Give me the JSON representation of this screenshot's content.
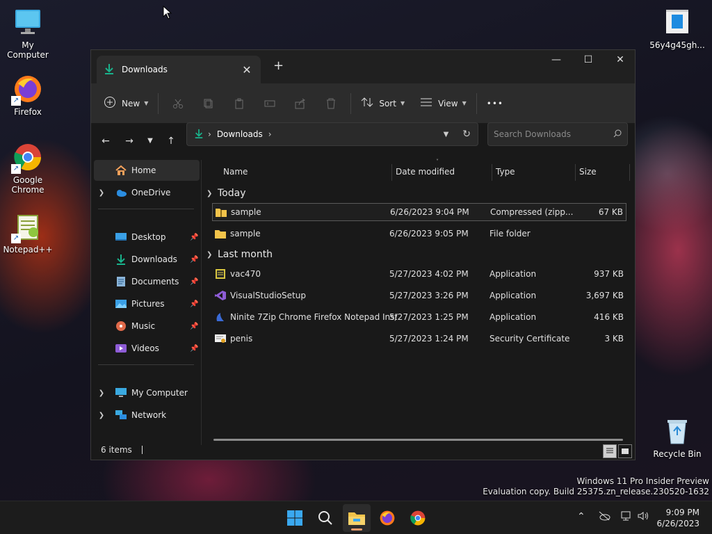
{
  "desktop": {
    "icons": [
      {
        "label": "My Computer"
      },
      {
        "label": "Firefox"
      },
      {
        "label": "Google Chrome"
      },
      {
        "label": "Notepad++"
      },
      {
        "label": "56y4g45gh..."
      },
      {
        "label": "Recycle Bin"
      }
    ],
    "watermark_line1": "Windows 11 Pro Insider Preview",
    "watermark_line2": "Evaluation copy. Build 25375.zn_release.230520-1632"
  },
  "explorer": {
    "tab_title": "Downloads",
    "tab_close": "✕",
    "new_tab": "+",
    "window_controls": {
      "minimize": "—",
      "maximize": "☐",
      "close": "✕"
    },
    "toolbar": {
      "new_label": "New",
      "sort_label": "Sort",
      "view_label": "View",
      "more": "•••"
    },
    "address": {
      "path": "Downloads",
      "separator": "›"
    },
    "search": {
      "placeholder": "Search Downloads"
    },
    "sidebar": {
      "home": "Home",
      "onedrive": "OneDrive",
      "desktop": "Desktop",
      "downloads": "Downloads",
      "documents": "Documents",
      "pictures": "Pictures",
      "music": "Music",
      "videos": "Videos",
      "mycomputer": "My Computer",
      "network": "Network"
    },
    "columns": {
      "name": "Name",
      "date": "Date modified",
      "type": "Type",
      "size": "Size"
    },
    "groups": {
      "today": {
        "label": "Today",
        "files": [
          {
            "name": "sample",
            "date": "6/26/2023 9:04 PM",
            "type": "Compressed (zipp...",
            "size": "67 KB",
            "icon": "zip-folder-icon"
          },
          {
            "name": "sample",
            "date": "6/26/2023 9:05 PM",
            "type": "File folder",
            "size": "",
            "icon": "folder-icon"
          }
        ]
      },
      "last_month": {
        "label": "Last month",
        "files": [
          {
            "name": "vac470",
            "date": "5/27/2023 4:02 PM",
            "type": "Application",
            "size": "937 KB",
            "icon": "app-icon"
          },
          {
            "name": "VisualStudioSetup",
            "date": "5/27/2023 3:26 PM",
            "type": "Application",
            "size": "3,697 KB",
            "icon": "visual-studio-icon"
          },
          {
            "name": "Ninite 7Zip Chrome Firefox Notepad Inst...",
            "date": "5/27/2023 1:25 PM",
            "type": "Application",
            "size": "416 KB",
            "icon": "ninite-icon"
          },
          {
            "name": "penis",
            "date": "5/27/2023 1:24 PM",
            "type": "Security Certificate",
            "size": "3 KB",
            "icon": "certificate-icon"
          }
        ]
      }
    },
    "status": {
      "items": "6 items"
    }
  },
  "taskbar": {
    "time": "9:09 PM",
    "date": "6/26/2023"
  },
  "colors": {
    "accent": "#0f9d8a",
    "folder": "#f2c34a",
    "window_bg": "#191919",
    "toolbar_bg": "#2c2c2c"
  }
}
